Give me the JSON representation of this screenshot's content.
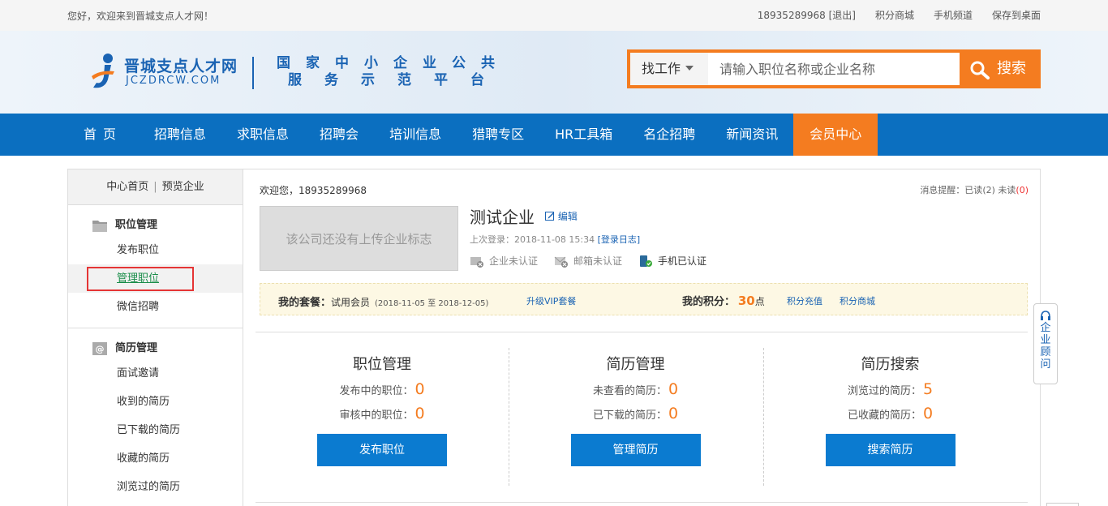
{
  "topbar": {
    "welcome": "您好，欢迎来到晋城支点人才网！",
    "user": "18935289968",
    "logout": "[退出]",
    "links": [
      "积分商城",
      "手机频道",
      "保存到桌面"
    ]
  },
  "header": {
    "logo_cn": "晋城支点人才网",
    "logo_en": "JCZDRCW.COM",
    "slogan_line1": "国家中小企业公共",
    "slogan_line2": "服务示范平台",
    "search": {
      "type_label": "找工作",
      "placeholder": "请输入职位名称或企业名称",
      "button": "搜索"
    }
  },
  "nav": [
    "首页",
    "招聘信息",
    "求职信息",
    "招聘会",
    "培训信息",
    "猎聘专区",
    "HR工具箱",
    "名企招聘",
    "新闻资讯",
    "会员中心"
  ],
  "sidebar": {
    "top_home": "中心首页",
    "top_preview": "预览企业",
    "sections": [
      {
        "title": "职位管理",
        "icon": "folder-icon",
        "links": [
          "发布职位",
          "管理职位",
          "微信招聘"
        ]
      },
      {
        "title": "简历管理",
        "icon": "at-icon",
        "links": [
          "面试邀请",
          "收到的简历",
          "已下载的简历",
          "收藏的简历",
          "浏览过的简历"
        ]
      }
    ]
  },
  "content": {
    "welcome": "欢迎您，18935289968",
    "msg_label": "消息提醒：已读",
    "msg_read": "(2)",
    "msg_unread_label": "未读",
    "msg_unread": "(0)",
    "logo_placeholder": "该公司还没有上传企业标志",
    "company_name": "测试企业",
    "edit": "编辑",
    "last_login_label": "上次登录：2018-11-08 15:34",
    "login_log": "[登录日志]",
    "certs": [
      "企业未认证",
      "邮箱未认证",
      "手机已认证"
    ],
    "package_label": "我的套餐：",
    "package_value": "试用会员",
    "package_dates": "(2018-11-05 至 2018-12-05)",
    "upgrade": "升级VIP套餐",
    "points_label": "我的积分：",
    "points_value": "30",
    "points_unit": "点",
    "recharge": "积分充值",
    "mall": "积分商城",
    "panels": [
      {
        "title": "职位管理",
        "rows": [
          {
            "label": "发布中的职位：",
            "value": "0"
          },
          {
            "label": "审核中的职位：",
            "value": "0"
          }
        ],
        "button": "发布职位"
      },
      {
        "title": "简历管理",
        "rows": [
          {
            "label": "未查看的简历：",
            "value": "0"
          },
          {
            "label": "已下载的简历：",
            "value": "0"
          }
        ],
        "button": "管理简历"
      },
      {
        "title": "简历搜索",
        "rows": [
          {
            "label": "浏览过的简历：",
            "value": "5"
          },
          {
            "label": "已收藏的简历：",
            "value": "0"
          }
        ],
        "button": "搜索简历"
      }
    ]
  },
  "consult": "企业顾问",
  "colors": {
    "brand_blue": "#0b6fc0",
    "accent_orange": "#f47c20",
    "link_blue": "#1a63b3"
  }
}
